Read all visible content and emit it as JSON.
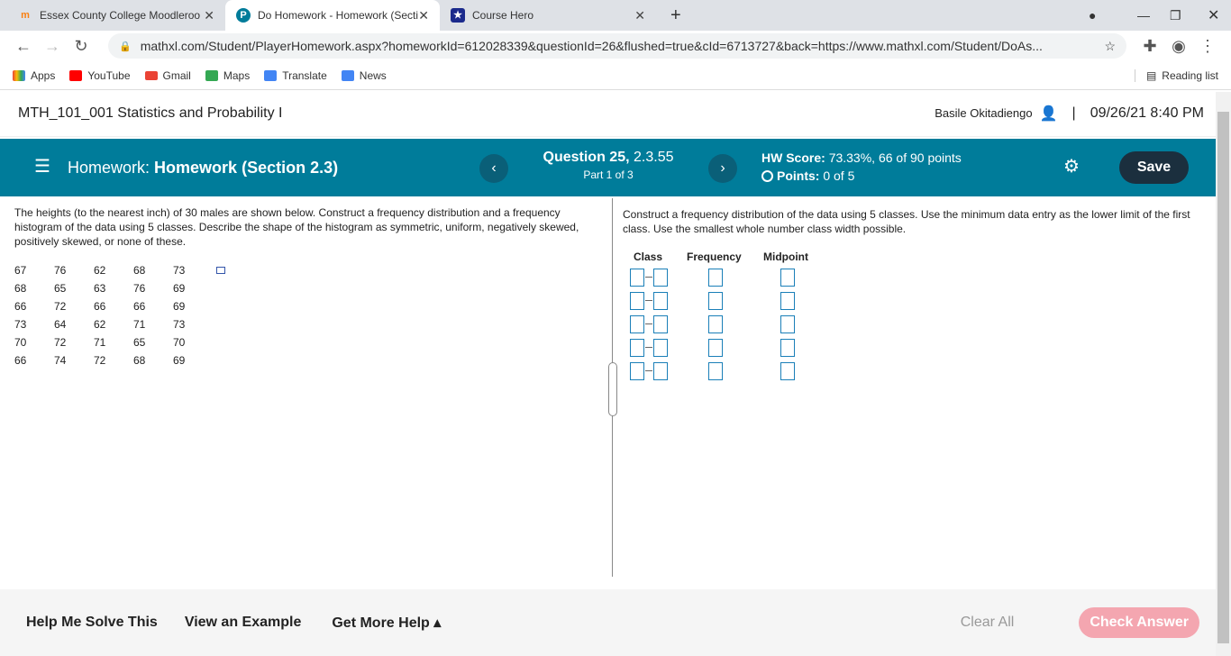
{
  "browser": {
    "tabs": [
      {
        "title": "Essex County College Moodleroo",
        "favicon": "moodle-icon"
      },
      {
        "title": "Do Homework - Homework (Secti",
        "favicon": "pearson-icon",
        "active": true
      },
      {
        "title": "Course Hero",
        "favicon": "coursehero-icon"
      }
    ],
    "url": "mathxl.com/Student/PlayerHomework.aspx?homeworkId=612028339&questionId=26&flushed=true&cId=6713727&back=https://www.mathxl.com/Student/DoAs...",
    "bookmarks": [
      "Apps",
      "YouTube",
      "Gmail",
      "Maps",
      "Translate",
      "News"
    ],
    "reading_list": "Reading list"
  },
  "course": {
    "title": "MTH_101_001 Statistics and Probability I",
    "user": "Basile Okitadiengo",
    "datetime": "09/26/21 8:40 PM",
    "separator": "|"
  },
  "toolbar": {
    "hw_prefix": "Homework:",
    "hw_title": "Homework (Section 2.3)",
    "question_label": "Question 25,",
    "question_num": "2.3.55",
    "part": "Part 1 of 3",
    "score_label": "HW Score:",
    "score_value": "73.33%, 66 of 90 points",
    "points_label": "Points:",
    "points_value": "0 of 5",
    "save": "Save",
    "prev": "‹",
    "next": "›"
  },
  "question": {
    "text": "The heights (to the nearest inch) of 30 males are shown below. Construct a frequency distribution and a frequency histogram of the data using 5 classes. Describe the shape of the histogram as symmetric, uniform, negatively skewed, positively skewed, or none of these.",
    "data": [
      [
        67,
        76,
        62,
        68,
        73
      ],
      [
        68,
        65,
        63,
        76,
        69
      ],
      [
        66,
        72,
        66,
        66,
        69
      ],
      [
        73,
        64,
        62,
        71,
        73
      ],
      [
        70,
        72,
        71,
        65,
        70
      ],
      [
        66,
        74,
        72,
        68,
        69
      ]
    ]
  },
  "answer": {
    "instructions": "Construct a frequency distribution of the data using 5 classes. Use the minimum data entry as the lower limit of the first class. Use the smallest whole number class width possible.",
    "headers": [
      "Class",
      "Frequency",
      "Midpoint"
    ],
    "rows": 5
  },
  "footer": {
    "help": "Help Me Solve This",
    "example": "View an Example",
    "more": "Get More Help ▴",
    "clear": "Clear All",
    "check": "Check Answer"
  },
  "colors": {
    "toolbar": "#007c9a",
    "save": "#1b2f3e",
    "check": "#f4a6b0",
    "input_border": "#1a7fb8"
  }
}
